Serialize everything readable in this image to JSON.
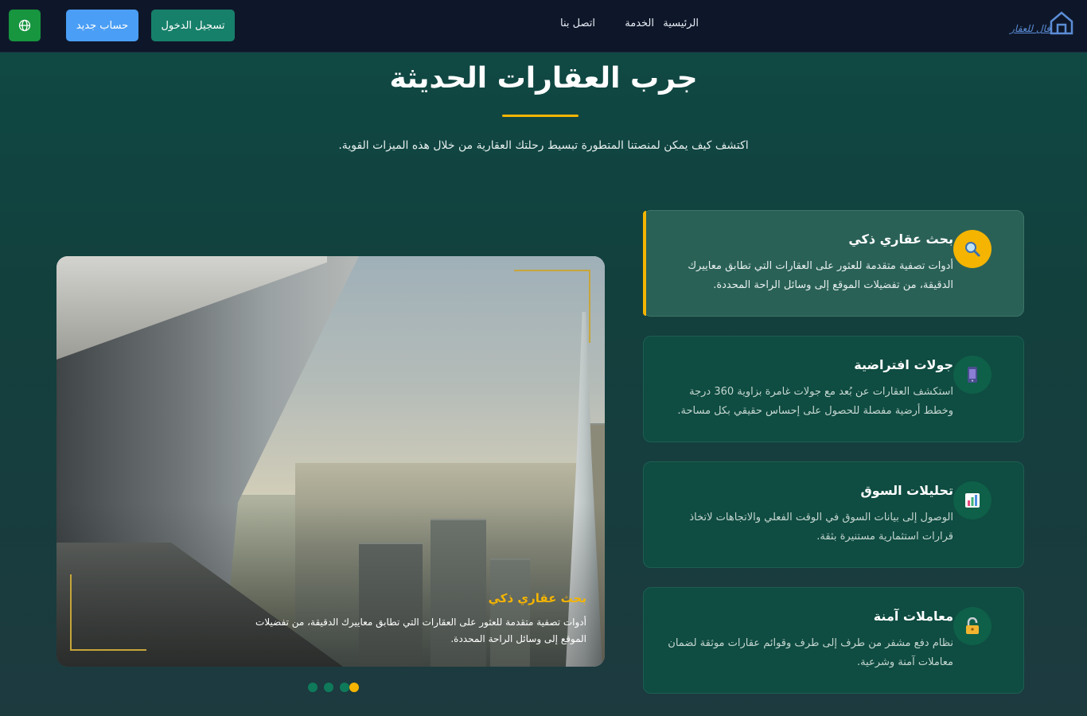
{
  "header": {
    "logo_text": "فال للعقار",
    "nav": [
      {
        "label": "الرئيسية"
      },
      {
        "label": "الخدمة"
      },
      {
        "label": "اتصل بنا"
      }
    ],
    "login_label": "تسجيل الدخول",
    "register_label": "حساب جديد",
    "language_icon": "globe-icon"
  },
  "hero": {
    "title": "جرب العقارات الحديثة",
    "subtitle": "اكتشف كيف يمكن لمنصتنا المتطورة تبسيط رحلتك العقارية من خلال هذه الميزات القوية."
  },
  "features": [
    {
      "title": "بحث عقاري ذكي",
      "description": "أدوات تصفية متقدمة للعثور على العقارات التي تطابق معاييرك الدقيقة، من تفضيلات الموقع إلى وسائل الراحة المحددة.",
      "icon": "magnifier-icon",
      "active": true
    },
    {
      "title": "جولات افتراضية",
      "description": "استكشف العقارات عن بُعد مع جولات غامرة بزاوية 360 درجة وخطط أرضية مفصلة للحصول على إحساس حقيقي بكل مساحة.",
      "icon": "phone-icon",
      "active": false
    },
    {
      "title": "تحليلات السوق",
      "description": "الوصول إلى بيانات السوق في الوقت الفعلي والاتجاهات لاتخاذ قرارات استثمارية مستنيرة بثقة.",
      "icon": "chart-icon",
      "active": false
    },
    {
      "title": "معاملات آمنة",
      "description": "نظام دفع مشفر من طرف إلى طرف وقوائم عقارات موثقة لضمان معاملات آمنة وشرعية.",
      "icon": "lock-icon",
      "active": false
    }
  ],
  "slider": {
    "caption_title": "بحث عقاري ذكي",
    "caption_description": "أدوات تصفية متقدمة للعثور على العقارات التي تطابق معاييرك الدقيقة، من تفضيلات الموقع إلى وسائل الراحة المحددة.",
    "active_slide": 4,
    "slide_count": 4
  },
  "colors": {
    "accent": "#f4b400",
    "nav_bg": "#0e1729",
    "login_bg": "#17806a",
    "register_bg": "#4a9ef5",
    "language_bg": "#17953f"
  }
}
